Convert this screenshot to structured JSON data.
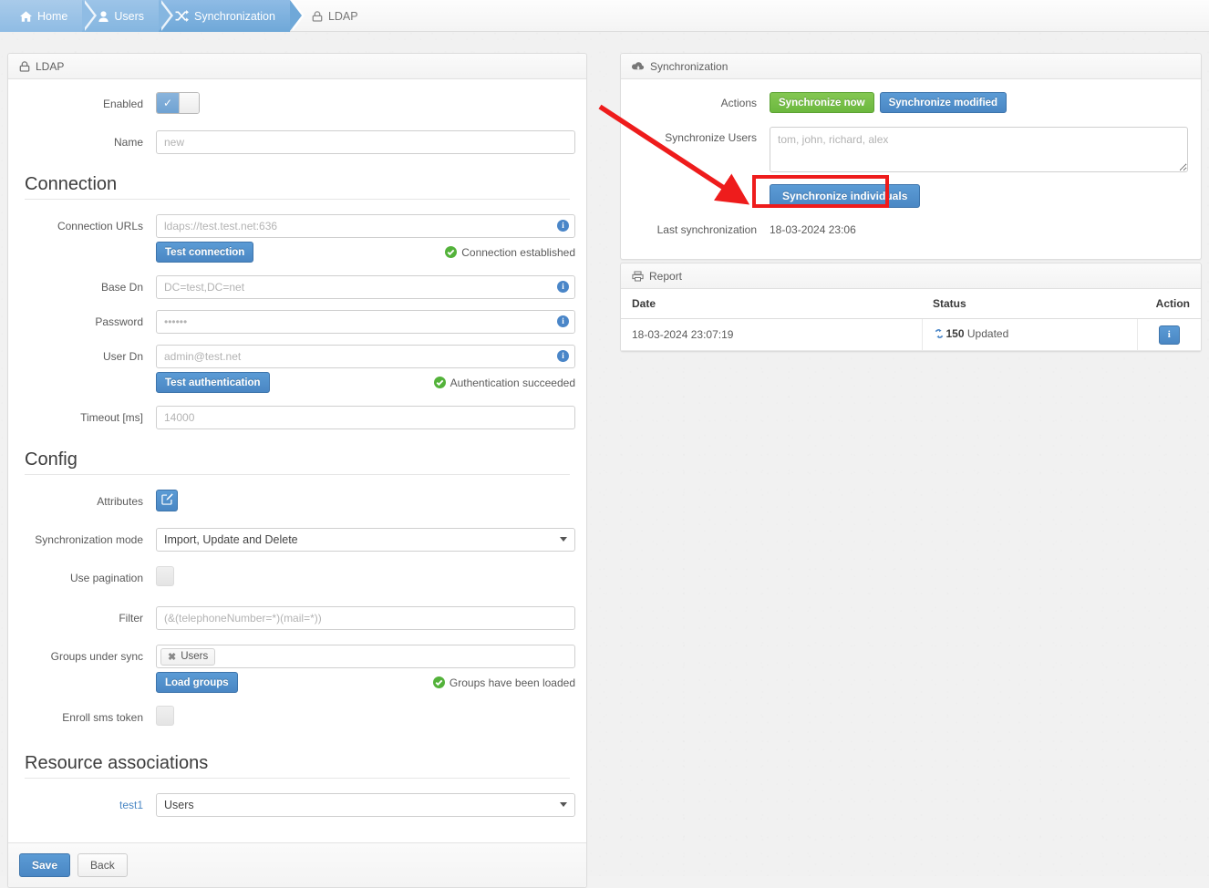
{
  "breadcrumb": {
    "items": [
      {
        "label": "Home",
        "icon": "home-icon",
        "state": "active"
      },
      {
        "label": "Users",
        "icon": "user-icon",
        "state": "active"
      },
      {
        "label": "Synchronization",
        "icon": "shuffle-icon",
        "state": "active"
      },
      {
        "label": "LDAP",
        "icon": "lock-icon",
        "state": "current"
      }
    ]
  },
  "ldap_panel": {
    "title": "LDAP",
    "title_icon": "lock-icon",
    "enabled": {
      "label": "Enabled",
      "state": "on",
      "check_glyph": "✓"
    },
    "name": {
      "label": "Name",
      "value": "new"
    },
    "connection_section": {
      "title": "Connection",
      "connection_urls": {
        "label": "Connection URLs",
        "value": "ldaps://test.test.net:636",
        "info": "i"
      },
      "test_connection": {
        "label": "Test connection",
        "status": "Connection established",
        "status_icon": "check-circle-icon"
      },
      "base_dn": {
        "label": "Base Dn",
        "value": "DC=test,DC=net",
        "info": "i"
      },
      "password": {
        "label": "Password",
        "value": "••••••",
        "info": "i"
      },
      "user_dn": {
        "label": "User Dn",
        "value": "admin@test.net",
        "info": "i"
      },
      "test_authentication": {
        "label": "Test authentication",
        "status": "Authentication succeeded",
        "status_icon": "check-circle-icon"
      },
      "timeout": {
        "label": "Timeout [ms]",
        "value": "14000"
      }
    },
    "config_section": {
      "title": "Config",
      "attributes": {
        "label": "Attributes",
        "icon": "edit-pencil-icon"
      },
      "sync_mode": {
        "label": "Synchronization mode",
        "value": "Import, Update and Delete",
        "options": [
          "Import, Update and Delete"
        ]
      },
      "use_pagination": {
        "label": "Use pagination",
        "state": "off"
      },
      "filter": {
        "label": "Filter",
        "value": "(&(telephoneNumber=*)(mail=*))"
      },
      "groups_under_sync": {
        "label": "Groups under sync",
        "tags": [
          "Users"
        ],
        "tag_remove_glyph": "✖"
      },
      "load_groups": {
        "label": "Load groups",
        "status": "Groups have been loaded",
        "status_icon": "check-circle-icon"
      },
      "enroll_sms_token": {
        "label": "Enroll sms token",
        "state": "off"
      }
    },
    "resource_section": {
      "title": "Resource associations",
      "rows": [
        {
          "label": "test1",
          "value": "Users",
          "options": [
            "Users"
          ]
        }
      ]
    },
    "footer": {
      "save_label": "Save",
      "back_label": "Back"
    }
  },
  "sync_panel": {
    "title": "Synchronization",
    "title_icon": "cloud-download-icon",
    "actions": {
      "label": "Actions",
      "sync_now_label": "Synchronize now",
      "sync_modified_label": "Synchronize modified"
    },
    "sync_users": {
      "label": "Synchronize Users",
      "placeholder": "tom, john, richard, alex",
      "value": ""
    },
    "sync_individuals_label": "Synchronize individuals",
    "last_sync": {
      "label": "Last synchronization",
      "value": "18-03-2024 23:06"
    }
  },
  "report_panel": {
    "title": "Report",
    "title_icon": "printer-icon",
    "columns": [
      "Date",
      "Status",
      "Action"
    ],
    "rows": [
      {
        "date": "18-03-2024 23:07:19",
        "status_icon": "sync-refresh-icon",
        "status_count": "150",
        "status_text": "Updated",
        "action_icon": "info-icon"
      }
    ]
  },
  "annotations": {
    "highlight_color": "#ee1c1c",
    "arrow_color": "#ee1c1c"
  },
  "colors": {
    "brand_blue": "#4a87c4",
    "success_green": "#6cb83f",
    "status_green": "#53b23a",
    "breadcrumb_blue": "#7fb0dd",
    "annotation_red": "#ee1c1c"
  }
}
